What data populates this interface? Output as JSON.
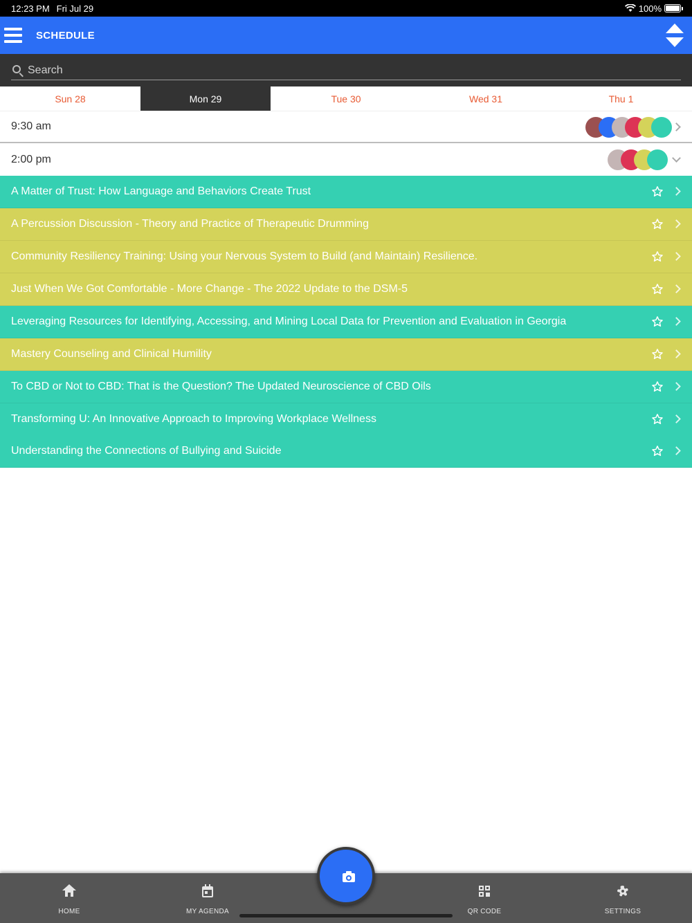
{
  "status_bar": {
    "time": "12:23 PM",
    "date": "Fri Jul 29",
    "battery": "100%"
  },
  "header": {
    "title": "SCHEDULE"
  },
  "search": {
    "placeholder": "Search"
  },
  "day_tabs": [
    {
      "label": "Sun 28",
      "active": false
    },
    {
      "label": "Mon 29",
      "active": true
    },
    {
      "label": "Tue 30",
      "active": false
    },
    {
      "label": "Wed 31",
      "active": false
    },
    {
      "label": "Thu 1",
      "active": false
    }
  ],
  "time_slots": [
    {
      "time": "9:30 am",
      "state": "collapsed",
      "track_colors": [
        "#9b5050",
        "#2b6ef5",
        "#c4b5b5",
        "#dd3355",
        "#d4d35a",
        "#33cfb0"
      ]
    },
    {
      "time": "2:00 pm",
      "state": "expanded",
      "track_colors": [
        "#c4b5b5",
        "#dd3355",
        "#d4d35a",
        "#33cfb0"
      ]
    }
  ],
  "colors": {
    "teal": "#35d0b2",
    "yellow": "#d4d35a",
    "accent": "#2b6ef5",
    "tab_text": "#e85a33"
  },
  "sessions": [
    {
      "title": "A Matter of Trust: How Language and Behaviors Create Trust",
      "color": "teal"
    },
    {
      "title": "A Percussion Discussion - Theory and Practice of Therapeutic Drumming",
      "color": "yellow"
    },
    {
      "title": "Community Resiliency Training: Using your Nervous System to Build (and Maintain) Resilience.",
      "color": "yellow"
    },
    {
      "title": "Just When We Got Comfortable - More Change - The 2022 Update to the DSM-5",
      "color": "yellow"
    },
    {
      "title": "Leveraging Resources for Identifying, Accessing, and Mining Local Data for Prevention and Evaluation in Georgia",
      "color": "teal"
    },
    {
      "title": "Mastery Counseling and Clinical Humility",
      "color": "yellow"
    },
    {
      "title": "To CBD or Not to CBD: That is the Question? The Updated Neuroscience of CBD Oils",
      "color": "teal"
    },
    {
      "title": "Transforming U: An Innovative Approach to Improving Workplace Wellness",
      "color": "teal"
    },
    {
      "title": "Understanding the Connections of Bullying and Suicide",
      "color": "teal"
    }
  ],
  "bottom_nav": {
    "home": "HOME",
    "agenda": "MY AGENDA",
    "qr": "QR CODE",
    "settings": "SETTINGS"
  },
  "icons": {
    "menu": "menu-icon",
    "sort": "sort-icon",
    "search": "search-icon",
    "star": "star-outline-icon",
    "chevron": "chevron-right-icon",
    "camera": "camera-icon",
    "home": "home-icon",
    "agenda": "calendar-icon",
    "qr": "qr-code-icon",
    "settings": "gear-icon"
  }
}
